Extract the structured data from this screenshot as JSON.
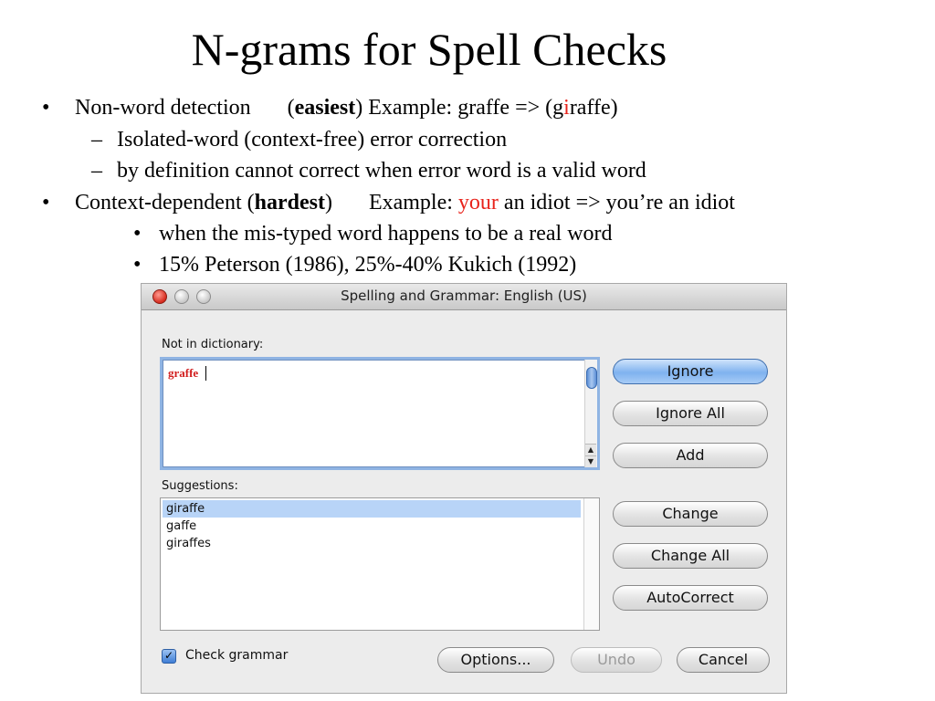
{
  "slide": {
    "title": "N-grams for Spell Checks",
    "bullets": [
      {
        "marker": "•",
        "text": "Non-word detection",
        "paren_open": "(",
        "emph": "easiest",
        "after": ") Example: graffe => (g",
        "red_char": "i",
        "tail": "raffe)"
      },
      {
        "marker": "–",
        "text": "Isolated-word (context-free) error correction"
      },
      {
        "marker": "–",
        "text": "by definition cannot correct when error word is a valid word"
      },
      {
        "marker": "•",
        "pre": "Context-dependent (",
        "emph": "hardest",
        "post": ")",
        "example_label": "Example: ",
        "red_word": "your",
        "example_rest": " an idiot  => you’re an idiot"
      },
      {
        "marker": "•",
        "text": "when the mis-typed word happens to be a real word"
      },
      {
        "marker": "•",
        "text": "15% Peterson (1986), 25%-40%  Kukich (1992)"
      }
    ]
  },
  "dialog": {
    "title": "Spelling and Grammar: English (US)",
    "not_in_dict_label": "Not in dictionary:",
    "misspelled_word": "graffe",
    "suggestions_label": "Suggestions:",
    "suggestions": [
      "giraffe",
      "gaffe",
      "giraffes"
    ],
    "selected_suggestion": "giraffe",
    "buttons": {
      "ignore": "Ignore",
      "ignore_all": "Ignore All",
      "add": "Add",
      "change": "Change",
      "change_all": "Change All",
      "autocorrect": "AutoCorrect",
      "options": "Options...",
      "undo": "Undo",
      "cancel": "Cancel"
    },
    "check_grammar_label": "Check grammar",
    "check_grammar_checked": true,
    "check_mark": "✓",
    "scroll_up": "▲",
    "scroll_down": "▼"
  },
  "colors": {
    "highlight_red": "#e8231b",
    "selection_blue": "#b8d4f7"
  }
}
